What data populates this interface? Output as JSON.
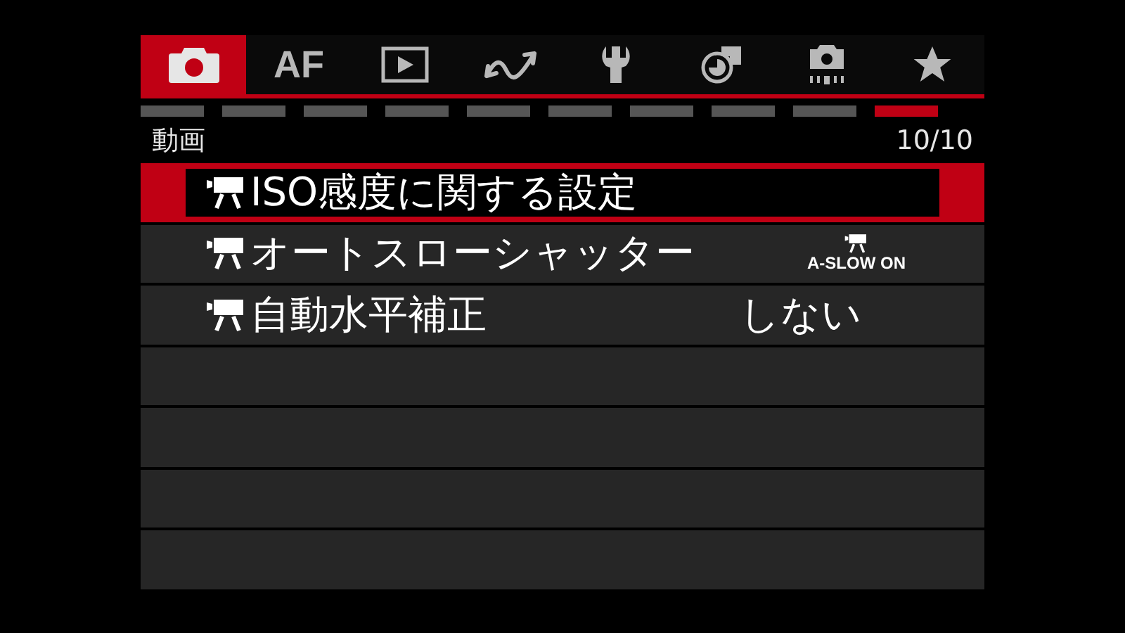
{
  "tabs": [
    {
      "kind": "camera",
      "selected": true
    },
    {
      "kind": "text",
      "label": "AF",
      "selected": false
    },
    {
      "kind": "play",
      "selected": false
    },
    {
      "kind": "wave",
      "selected": false
    },
    {
      "kind": "wrench",
      "selected": false
    },
    {
      "kind": "chart",
      "selected": false
    },
    {
      "kind": "camera-dots",
      "selected": false
    },
    {
      "kind": "star",
      "selected": false
    }
  ],
  "pages": [
    {
      "selected": false
    },
    {
      "selected": false
    },
    {
      "selected": false
    },
    {
      "selected": false
    },
    {
      "selected": false
    },
    {
      "selected": false
    },
    {
      "selected": false
    },
    {
      "selected": false
    },
    {
      "selected": false
    },
    {
      "selected": true
    }
  ],
  "header": {
    "title": "動画",
    "page": "10/10"
  },
  "items": [
    {
      "kind": "movie",
      "label": "ISO感度に関する設定",
      "selected": true
    },
    {
      "kind": "movie",
      "label": "オートスローシャッター",
      "selected": false,
      "value": {
        "kind": "icon-text",
        "text": "A-SLOW ON"
      }
    },
    {
      "kind": "movie",
      "label": "自動水平補正",
      "selected": false,
      "value": {
        "kind": "text",
        "text": "しない"
      }
    },
    {
      "kind": "empty",
      "selected": false
    },
    {
      "kind": "empty",
      "selected": false
    },
    {
      "kind": "empty",
      "selected": false
    },
    {
      "kind": "empty",
      "selected": false
    }
  ]
}
